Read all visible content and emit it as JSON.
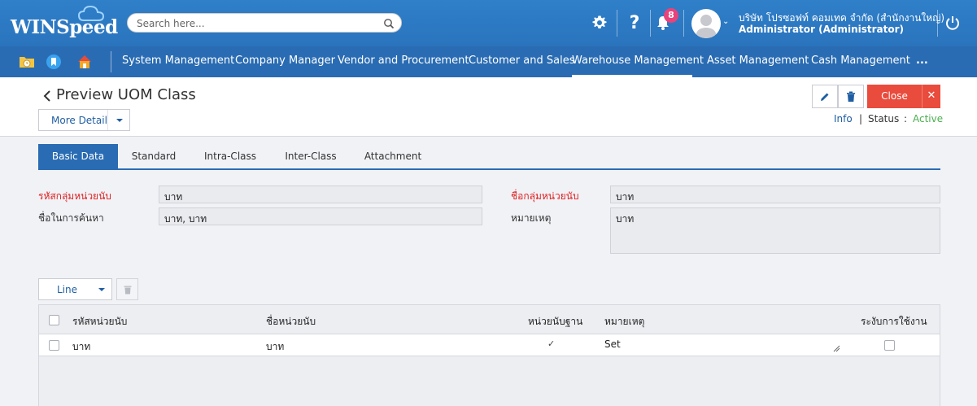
{
  "brand": {
    "logo_text": "WINSpeed",
    "accent": "#2a6cb3"
  },
  "header": {
    "search_placeholder": "Search here...",
    "notifications_count": "8",
    "company_name": "บริษัท โปรซอฟท์ คอมเทค จำกัด (สำนักงานใหญ่)",
    "user_name": "Administrator (Administrator)"
  },
  "nav": {
    "items": [
      {
        "label": "System Management"
      },
      {
        "label": "Company Manager"
      },
      {
        "label": "Vendor and Procurement"
      },
      {
        "label": "Customer and Sales"
      },
      {
        "label": "Warehouse Management"
      },
      {
        "label": "Asset Management"
      },
      {
        "label": "Cash Management"
      },
      {
        "label": "..."
      }
    ],
    "active": "Warehouse Management"
  },
  "page": {
    "title": "Preview UOM Class",
    "more_detail_label": "More Detail",
    "close_label": "Close",
    "info_label": "Info",
    "status_label": "Status",
    "status_value": "Active",
    "status_color": "#4caf50"
  },
  "tabs": [
    {
      "label": "Basic Data"
    },
    {
      "label": "Standard"
    },
    {
      "label": "Intra-Class"
    },
    {
      "label": "Inter-Class"
    },
    {
      "label": "Attachment"
    }
  ],
  "form": {
    "group_code_label": "รหัสกลุ่มหน่วยนับ",
    "group_code_value": "บาท",
    "search_name_label": "ชื่อในการค้นหา",
    "search_name_value": "บาท, บาท",
    "group_name_label": "ชื่อกลุ่มหน่วยนับ",
    "group_name_value": "บาท",
    "remark_label": "หมายเหตุ",
    "remark_value": "บาท"
  },
  "lines": {
    "line_button_label": "Line",
    "columns": {
      "unit_code": "รหัสหน่วยนับ",
      "unit_name": "ชื่อหน่วยนับ",
      "base_unit": "หน่วยนับฐาน",
      "remark": "หมายเหตุ",
      "suspend": "ระงับการใช้งาน"
    },
    "rows": [
      {
        "unit_code": "บาท",
        "unit_name": "บาท",
        "base_unit_mark": "✓",
        "remark": "Set"
      }
    ]
  }
}
